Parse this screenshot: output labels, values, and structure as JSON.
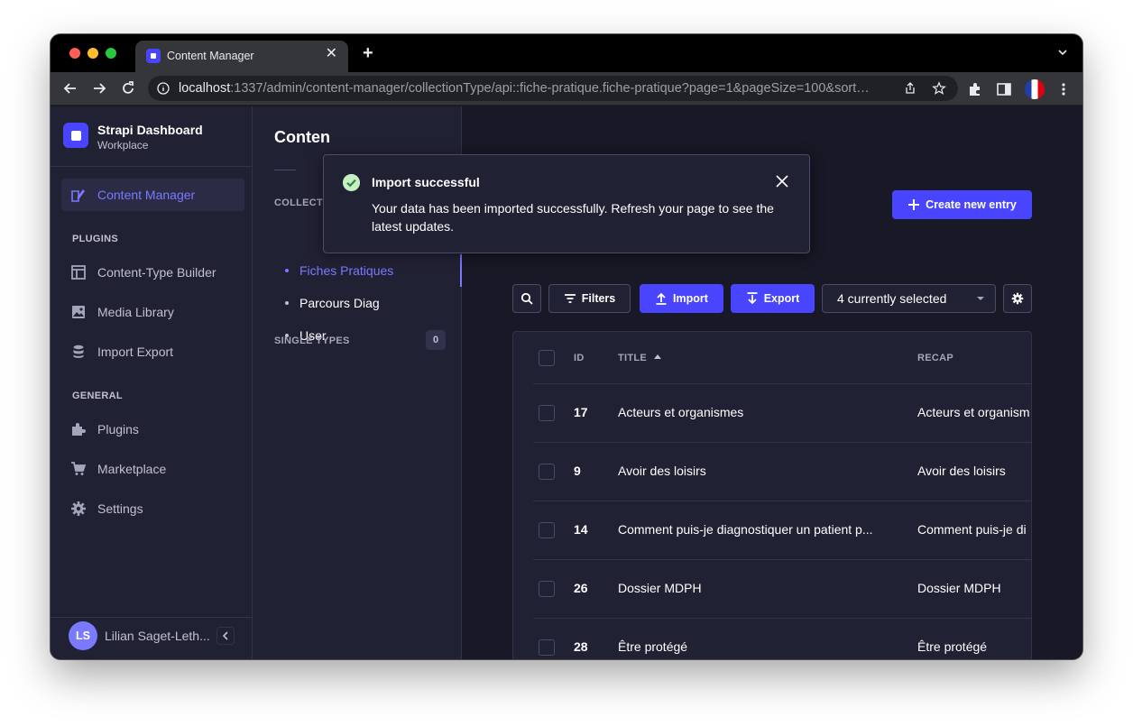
{
  "browser": {
    "tab_title": "Content Manager",
    "url_host": "localhost",
    "url_rest": ":1337/admin/content-manager/collectionType/api::fiche-pratique.fiche-pratique?page=1&pageSize=100&sort…"
  },
  "sidebar": {
    "brand_name": "Strapi Dashboard",
    "brand_sub": "Workplace",
    "active_item": "Content Manager",
    "plugins_label": "PLUGINS",
    "plugins": [
      "Content-Type Builder",
      "Media Library",
      "Import Export"
    ],
    "general_label": "GENERAL",
    "general": [
      "Plugins",
      "Marketplace",
      "Settings"
    ],
    "user_initials": "LS",
    "user_name": "Lilian Saget-Leth..."
  },
  "subnav": {
    "title": "Conten",
    "collection_label": "COLLECTI",
    "items": [
      "Fiches Pratiques",
      "Parcours Diag",
      "User"
    ],
    "single_types_label": "SINGLE TYPES",
    "single_types_count": "0"
  },
  "main": {
    "create_button": "Create new entry",
    "filters_button": "Filters",
    "import_button": "Import",
    "export_button": "Export",
    "selection": "4 currently selected",
    "columns": {
      "id": "ID",
      "title": "TITLE",
      "recap": "RECAP"
    },
    "rows": [
      {
        "id": "17",
        "title": "Acteurs et organismes",
        "recap": "Acteurs et organism"
      },
      {
        "id": "9",
        "title": "Avoir des loisirs",
        "recap": "Avoir des loisirs"
      },
      {
        "id": "14",
        "title": "Comment puis-je diagnostiquer un patient p...",
        "recap": "Comment puis-je di"
      },
      {
        "id": "26",
        "title": "Dossier MDPH",
        "recap": "Dossier MDPH"
      },
      {
        "id": "28",
        "title": "Être protégé",
        "recap": "Être protégé"
      }
    ]
  },
  "toast": {
    "title": "Import successful",
    "message": "Your data has been imported successfully. Refresh your page to see the latest updates."
  },
  "help": "?",
  "colors": {
    "primary": "#4945ff",
    "accent": "#7b79ff",
    "success": "#c6f0c2",
    "background": "#181826",
    "surface": "#212134"
  }
}
